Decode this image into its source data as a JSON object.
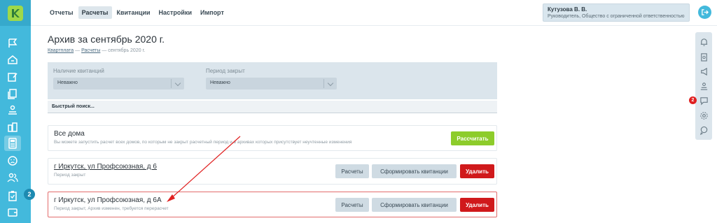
{
  "app": {
    "logo_icon": "k-logo-icon",
    "brand_color": "#9ed94a",
    "sidebar_color": "#43b9dc"
  },
  "nav": {
    "tabs": [
      {
        "label": "Отчеты"
      },
      {
        "label": "Расчеты",
        "active": true
      },
      {
        "label": "Квитанции"
      },
      {
        "label": "Настройки"
      },
      {
        "label": "Импорт"
      }
    ]
  },
  "user": {
    "name": "Кутузова В. В.",
    "role": "Руководитель, Общество с ограниченной ответственностью «Ав..."
  },
  "sidebar": {
    "icons": [
      "flag-icon",
      "home-chat-icon",
      "edit-doc-icon",
      "documents-icon",
      "hand-coin-icon",
      "buildings-icon",
      "calculator-icon",
      "sad-face-icon",
      "users-icon",
      "clipboard-icon",
      "wallet-icon"
    ],
    "active_index": 6,
    "badge": "2"
  },
  "right_panel": {
    "icons": [
      "bell-icon",
      "clipboard-icon",
      "megaphone-icon",
      "hand-coin-icon",
      "chat-icon",
      "gear-icon",
      "chat-bubbles-icon"
    ],
    "badge": "2"
  },
  "page": {
    "title": "Архив за сентябрь 2020 г.",
    "breadcrumb": {
      "item1": "Квартплата",
      "item2": "Расчеты",
      "current": "сентябрь 2020 г.",
      "separator": " — "
    }
  },
  "filters": {
    "receipts_label": "Наличие квитанций",
    "receipts_value": "Неважно",
    "period_label": "Период закрыт",
    "period_value": "Неважно"
  },
  "search": {
    "placeholder": "Быстрый поиск..."
  },
  "all_houses": {
    "title": "Все дома",
    "description": "Вы можете запустить расчет всех домов, по которым не закрыт расчетный период и в архивах которых присутствует неучтенные изменения",
    "button": "Рассчитать"
  },
  "houses": [
    {
      "title": "г Иркутск, ул Профсоюзная, д 6",
      "status": "Период закрыт",
      "btn_calc": "Расчеты",
      "btn_form": "Сформировать квитанции",
      "btn_delete": "Удалить"
    },
    {
      "title": "г Иркутск, ул Профсоюзная, д 6А",
      "status": "Период закрыт, Архив изменен, требуется перерасчет",
      "btn_calc": "Расчеты",
      "btn_form": "Сформировать квитанции",
      "btn_delete": "Удалить"
    }
  ],
  "colors": {
    "primary_button": "#8dcc2b",
    "delete_button": "#d0191b",
    "highlight_border": "#e26c6c",
    "arrow": "#e02020"
  }
}
